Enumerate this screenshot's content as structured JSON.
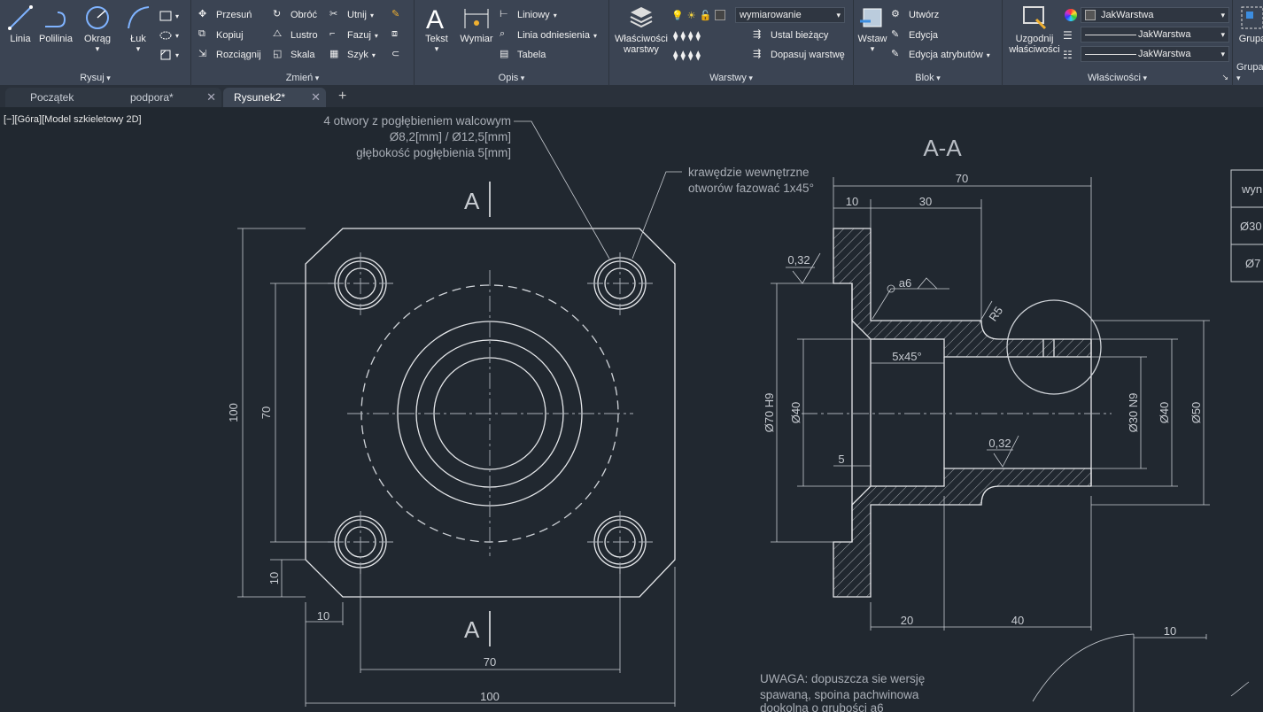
{
  "ribbon": {
    "rysuj": {
      "title": "Rysuj",
      "linia": "Linia",
      "polilinia": "Polilinia",
      "okrag": "Okrąg",
      "luk": "Łuk"
    },
    "zmien": {
      "title": "Zmień",
      "przesun": "Przesuń",
      "obroc": "Obróć",
      "utnij": "Utnij",
      "kopiuj": "Kopiuj",
      "lustro": "Lustro",
      "fazuj": "Fazuj",
      "rozciagnij": "Rozciągnij",
      "skala": "Skala",
      "szyk": "Szyk"
    },
    "opis": {
      "title": "Opis",
      "tekst": "Tekst",
      "wymiar": "Wymiar",
      "liniowy": "Liniowy",
      "linia_odniesienia": "Linia odniesienia",
      "tabela": "Tabela"
    },
    "warstwy": {
      "title": "Warstwy",
      "wlasciwosci_warstwy_1": "Właściwości",
      "wlasciwosci_warstwy_2": "warstwy",
      "current_layer": "wymiarowanie",
      "ustal_biezacy": "Ustal bieżący",
      "dopasuj_warstwe": "Dopasuj warstwę"
    },
    "blok": {
      "title": "Blok",
      "wstaw": "Wstaw",
      "utworz": "Utwórz",
      "edycja": "Edycja",
      "edycja_atrybutow": "Edycja atrybutów"
    },
    "wlasciwosci": {
      "title": "Właściwości",
      "uzgodnij_1": "Uzgodnij",
      "uzgodnij_2": "właściwości",
      "color": "JakWarstwa",
      "linetype": "JakWarstwa",
      "lineweight": "JakWarstwa"
    },
    "grupa": {
      "title": "Grupa",
      "btn": "Grupa"
    }
  },
  "tabs": [
    {
      "label": "Początek",
      "active": false
    },
    {
      "label": "podpora*",
      "active": false
    },
    {
      "label": "Rysunek2*",
      "active": true
    }
  ],
  "viewport_label": "[−][Góra][Model szkieletowy 2D]",
  "drawing": {
    "note_holes_1": "4 otwory z pogłębieniem walcowym",
    "note_holes_2": "Ø8,2[mm] / Ø12,5[mm]",
    "note_holes_3": "głębokość pogłębienia 5[mm]",
    "note_edges_1": "krawędzie wewnętrzne",
    "note_edges_2": "otworów fazować 1x45°",
    "section_mark": "A",
    "section_title": "A-A",
    "dim_100_v": "100",
    "dim_70_v": "70",
    "dim_10_v": "10",
    "dim_10_h": "10",
    "dim_70_h": "70",
    "dim_100_h": "100",
    "dim_sec_70": "70",
    "dim_sec_10": "10",
    "dim_sec_30": "30",
    "rough_1": "0,32",
    "rough_2": "0,32",
    "weld": "a6",
    "radius": "R5",
    "chamfer": "5x45°",
    "dim_phi70": "Ø70 H9",
    "dim_phi40_l": "Ø40",
    "dim_5": "5",
    "dim_phi30": "Ø30 N9",
    "dim_phi40_r": "Ø40",
    "dim_phi50": "Ø50",
    "dim_20": "20",
    "dim_40": "40",
    "dim_10_br": "10",
    "warning_1": "UWAGA: dopuszcza sie wersję",
    "warning_2": "spawaną, spoina pachwinowa",
    "warning_3": "dookolna o grubości a6",
    "table_1": "wyn",
    "table_2": "Ø30",
    "table_3": "Ø7"
  }
}
